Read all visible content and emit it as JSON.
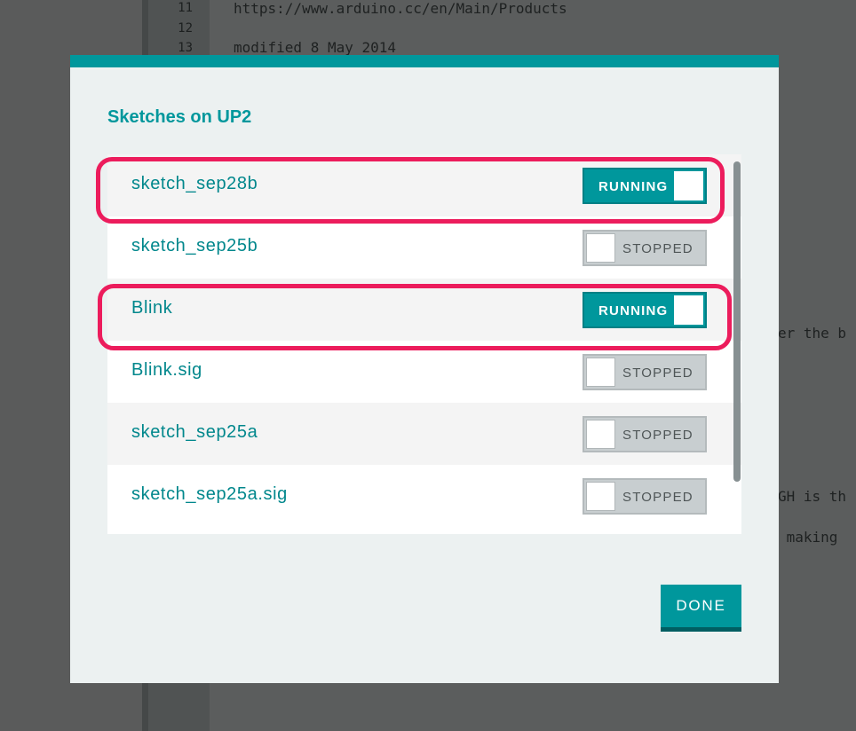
{
  "editor": {
    "line_numbers": [
      "11",
      "12",
      "13"
    ],
    "lines": [
      "https://www.arduino.cc/en/Main/Products",
      "",
      "modified 8 May 2014"
    ],
    "right_fragments": [
      "er the b",
      "GH is th",
      " making "
    ]
  },
  "dialog": {
    "title": "Sketches on UP2",
    "sketches": [
      {
        "name": "sketch_sep28b",
        "state": "RUNNING",
        "highlighted": true
      },
      {
        "name": "sketch_sep25b",
        "state": "STOPPED",
        "highlighted": false
      },
      {
        "name": "Blink",
        "state": "RUNNING",
        "highlighted": true
      },
      {
        "name": "Blink.sig",
        "state": "STOPPED",
        "highlighted": false
      },
      {
        "name": "sketch_sep25a",
        "state": "STOPPED",
        "highlighted": false
      },
      {
        "name": "sketch_sep25a.sig",
        "state": "STOPPED",
        "highlighted": false
      }
    ],
    "done_label": "DONE"
  },
  "colors": {
    "accent": "#00979c",
    "highlight": "#ec1c5c",
    "toggle_off": "#c8ced0"
  }
}
